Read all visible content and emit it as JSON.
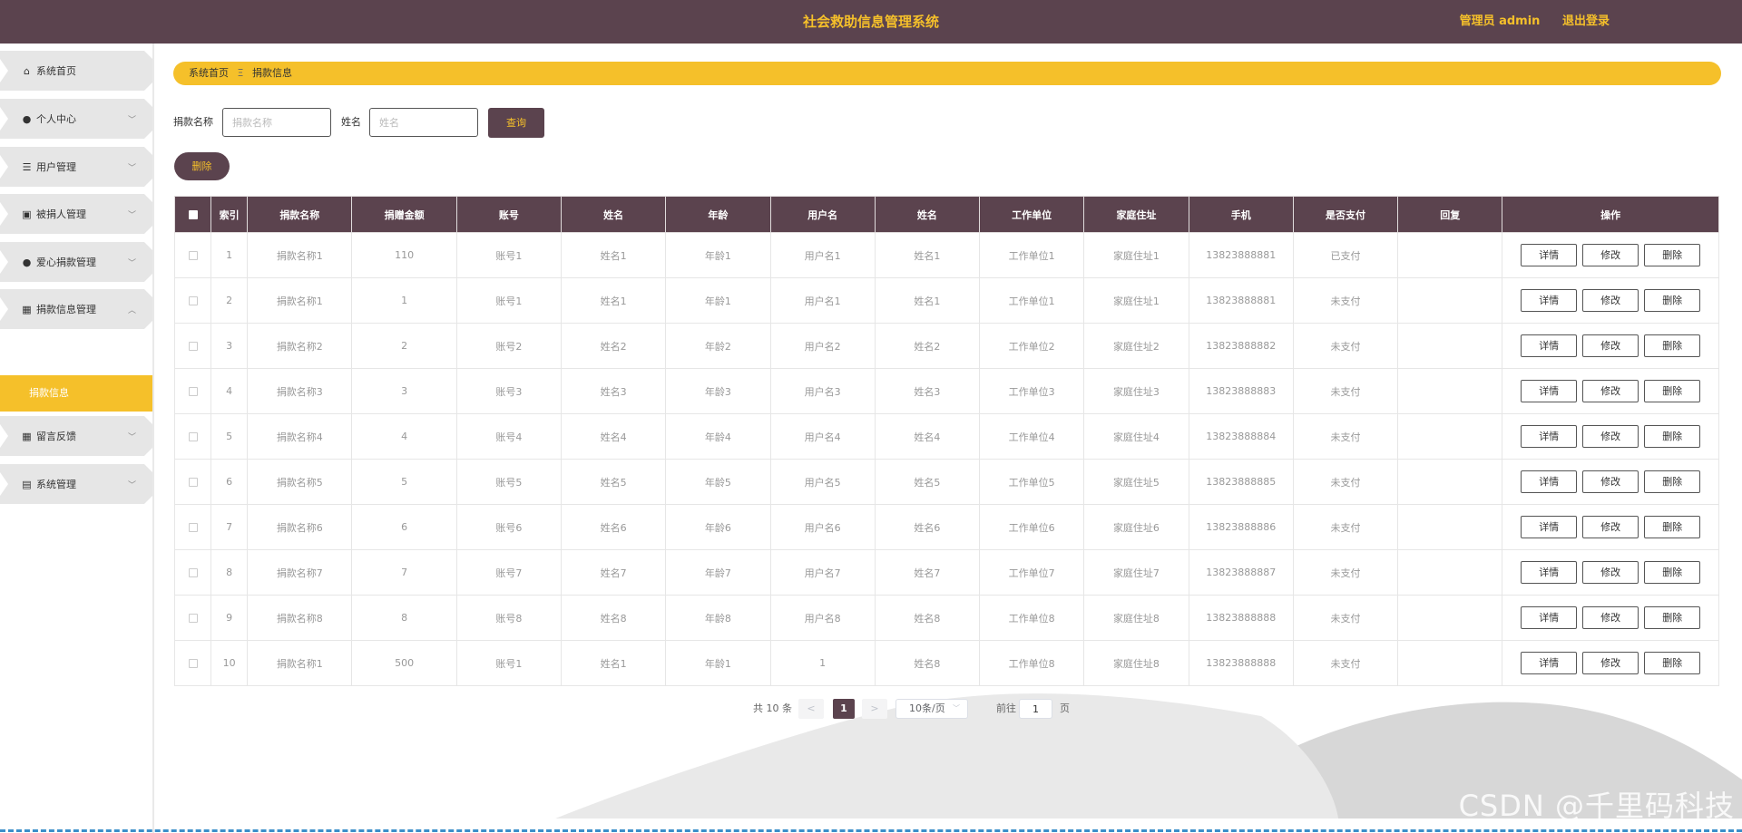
{
  "header": {
    "title": "社会救助信息管理系统",
    "user_label": "管理员 admin",
    "logout_label": "退出登录"
  },
  "sidebar": {
    "items": [
      {
        "label": "系统首页",
        "icon": "home-icon"
      },
      {
        "label": "个人中心",
        "icon": "user-icon"
      },
      {
        "label": "用户管理",
        "icon": "list-icon"
      },
      {
        "label": "被捐人管理",
        "icon": "briefcase-icon"
      },
      {
        "label": "爱心捐款管理",
        "icon": "lightbulb-icon"
      },
      {
        "label": "捐款信息管理",
        "icon": "grid-icon"
      },
      {
        "label": "留言反馈",
        "icon": "grid-icon"
      },
      {
        "label": "系统管理",
        "icon": "clipboard-icon"
      }
    ],
    "active_sub": "捐款信息"
  },
  "breadcrumb": {
    "home": "系统首页",
    "separator": "Ξ",
    "current": "捐款信息"
  },
  "search": {
    "donation_name_label": "捐款名称",
    "donation_name_placeholder": "捐款名称",
    "name_label": "姓名",
    "name_placeholder": "姓名",
    "query_label": "查询"
  },
  "toolbar": {
    "delete_label": "删除"
  },
  "table": {
    "headers": [
      "索引",
      "捐款名称",
      "捐赠金额",
      "账号",
      "姓名",
      "年龄",
      "用户名",
      "姓名",
      "工作单位",
      "家庭住址",
      "手机",
      "是否支付",
      "回复",
      "操作"
    ],
    "rows": [
      [
        "1",
        "捐款名称1",
        "110",
        "账号1",
        "姓名1",
        "年龄1",
        "用户名1",
        "姓名1",
        "工作单位1",
        "家庭住址1",
        "13823888881",
        "已支付",
        ""
      ],
      [
        "2",
        "捐款名称1",
        "1",
        "账号1",
        "姓名1",
        "年龄1",
        "用户名1",
        "姓名1",
        "工作单位1",
        "家庭住址1",
        "13823888881",
        "未支付",
        ""
      ],
      [
        "3",
        "捐款名称2",
        "2",
        "账号2",
        "姓名2",
        "年龄2",
        "用户名2",
        "姓名2",
        "工作单位2",
        "家庭住址2",
        "13823888882",
        "未支付",
        ""
      ],
      [
        "4",
        "捐款名称3",
        "3",
        "账号3",
        "姓名3",
        "年龄3",
        "用户名3",
        "姓名3",
        "工作单位3",
        "家庭住址3",
        "13823888883",
        "未支付",
        ""
      ],
      [
        "5",
        "捐款名称4",
        "4",
        "账号4",
        "姓名4",
        "年龄4",
        "用户名4",
        "姓名4",
        "工作单位4",
        "家庭住址4",
        "13823888884",
        "未支付",
        ""
      ],
      [
        "6",
        "捐款名称5",
        "5",
        "账号5",
        "姓名5",
        "年龄5",
        "用户名5",
        "姓名5",
        "工作单位5",
        "家庭住址5",
        "13823888885",
        "未支付",
        ""
      ],
      [
        "7",
        "捐款名称6",
        "6",
        "账号6",
        "姓名6",
        "年龄6",
        "用户名6",
        "姓名6",
        "工作单位6",
        "家庭住址6",
        "13823888886",
        "未支付",
        ""
      ],
      [
        "8",
        "捐款名称7",
        "7",
        "账号7",
        "姓名7",
        "年龄7",
        "用户名7",
        "姓名7",
        "工作单位7",
        "家庭住址7",
        "13823888887",
        "未支付",
        ""
      ],
      [
        "9",
        "捐款名称8",
        "8",
        "账号8",
        "姓名8",
        "年龄8",
        "用户名8",
        "姓名8",
        "工作单位8",
        "家庭住址8",
        "13823888888",
        "未支付",
        ""
      ],
      [
        "10",
        "捐款名称1",
        "500",
        "账号1",
        "姓名1",
        "年龄1",
        "1",
        "姓名8",
        "工作单位8",
        "家庭住址8",
        "13823888888",
        "未支付",
        ""
      ]
    ],
    "actions": {
      "detail": "详情",
      "edit": "修改",
      "delete": "删除"
    }
  },
  "pagination": {
    "total_label": "共 10 条",
    "prev": "<",
    "next": ">",
    "current_page": "1",
    "page_size": "10条/页",
    "goto_label": "前往",
    "goto_value": "1",
    "page_suffix": "页"
  },
  "watermark": "CSDN @千里码科技",
  "colors": {
    "header_bg": "#5b434e",
    "accent": "#f5c02a",
    "menu_bg": "#e6e6e6"
  }
}
